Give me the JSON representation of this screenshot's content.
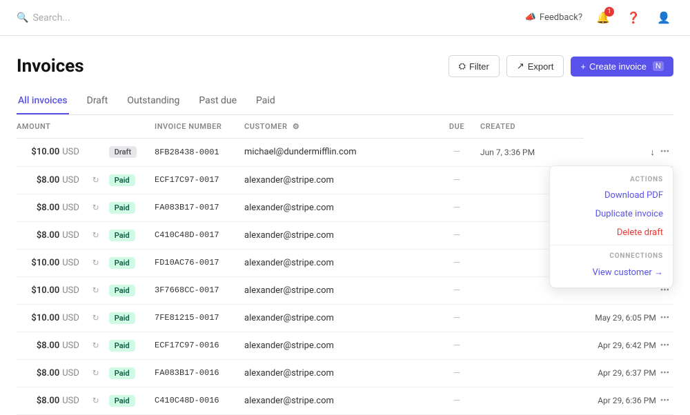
{
  "header": {
    "search_placeholder": "Search...",
    "search_label": "Search -",
    "feedback_label": "Feedback?",
    "notification_count": "1"
  },
  "page": {
    "title": "Invoices",
    "filter_label": "Filter",
    "export_label": "Export",
    "create_label": "Create invoice",
    "create_shortcut": "N"
  },
  "tabs": [
    {
      "label": "All invoices",
      "active": true
    },
    {
      "label": "Draft",
      "active": false
    },
    {
      "label": "Outstanding",
      "active": false
    },
    {
      "label": "Past due",
      "active": false
    },
    {
      "label": "Paid",
      "active": false
    }
  ],
  "table": {
    "columns": [
      "AMOUNT",
      "INVOICE NUMBER",
      "CUSTOMER",
      "DUE",
      "CREATED"
    ],
    "rows": [
      {
        "amount": "$10.00",
        "currency": "USD",
        "sync": false,
        "badge": "Draft",
        "badge_type": "draft",
        "number": "8FB28438-0001",
        "customer": "michael@dundermifflin.com",
        "due": "—",
        "created": "Jun 7, 3:36 PM",
        "has_dropdown": true
      },
      {
        "amount": "$8.00",
        "currency": "USD",
        "sync": true,
        "badge": "Paid",
        "badge_type": "paid",
        "number": "ECF17C97-0017",
        "customer": "alexander@stripe.com",
        "due": "—",
        "created": "",
        "has_dropdown": false
      },
      {
        "amount": "$8.00",
        "currency": "USD",
        "sync": true,
        "badge": "Paid",
        "badge_type": "paid",
        "number": "FA083B17-0017",
        "customer": "alexander@stripe.com",
        "due": "—",
        "created": "",
        "has_dropdown": false
      },
      {
        "amount": "$8.00",
        "currency": "USD",
        "sync": true,
        "badge": "Paid",
        "badge_type": "paid",
        "number": "C410C48D-0017",
        "customer": "alexander@stripe.com",
        "due": "—",
        "created": "",
        "has_dropdown": false
      },
      {
        "amount": "$10.00",
        "currency": "USD",
        "sync": true,
        "badge": "Paid",
        "badge_type": "paid",
        "number": "FD10AC76-0017",
        "customer": "alexander@stripe.com",
        "due": "—",
        "created": "",
        "has_dropdown": false
      },
      {
        "amount": "$10.00",
        "currency": "USD",
        "sync": true,
        "badge": "Paid",
        "badge_type": "paid",
        "number": "3F7668CC-0017",
        "customer": "alexander@stripe.com",
        "due": "—",
        "created": "",
        "has_dropdown": false
      },
      {
        "amount": "$10.00",
        "currency": "USD",
        "sync": true,
        "badge": "Paid",
        "badge_type": "paid",
        "number": "7FE81215-0017",
        "customer": "alexander@stripe.com",
        "due": "—",
        "created": "May 29, 6:05 PM",
        "has_dropdown": false
      },
      {
        "amount": "$8.00",
        "currency": "USD",
        "sync": true,
        "badge": "Paid",
        "badge_type": "paid",
        "number": "ECF17C97-0016",
        "customer": "alexander@stripe.com",
        "due": "—",
        "created": "Apr 29, 6:42 PM",
        "has_dropdown": false
      },
      {
        "amount": "$8.00",
        "currency": "USD",
        "sync": true,
        "badge": "Paid",
        "badge_type": "paid",
        "number": "FA083B17-0016",
        "customer": "alexander@stripe.com",
        "due": "—",
        "created": "Apr 29, 6:37 PM",
        "has_dropdown": false
      },
      {
        "amount": "$8.00",
        "currency": "USD",
        "sync": true,
        "badge": "Paid",
        "badge_type": "paid",
        "number": "C410C48D-0016",
        "customer": "alexander@stripe.com",
        "due": "—",
        "created": "Apr 29, 6:36 PM",
        "has_dropdown": false
      }
    ]
  },
  "dropdown": {
    "actions_label": "ACTIONS",
    "download_pdf": "Download PDF",
    "duplicate_invoice": "Duplicate invoice",
    "delete_draft": "Delete draft",
    "connections_label": "CONNECTIONS",
    "view_customer": "View customer →"
  }
}
